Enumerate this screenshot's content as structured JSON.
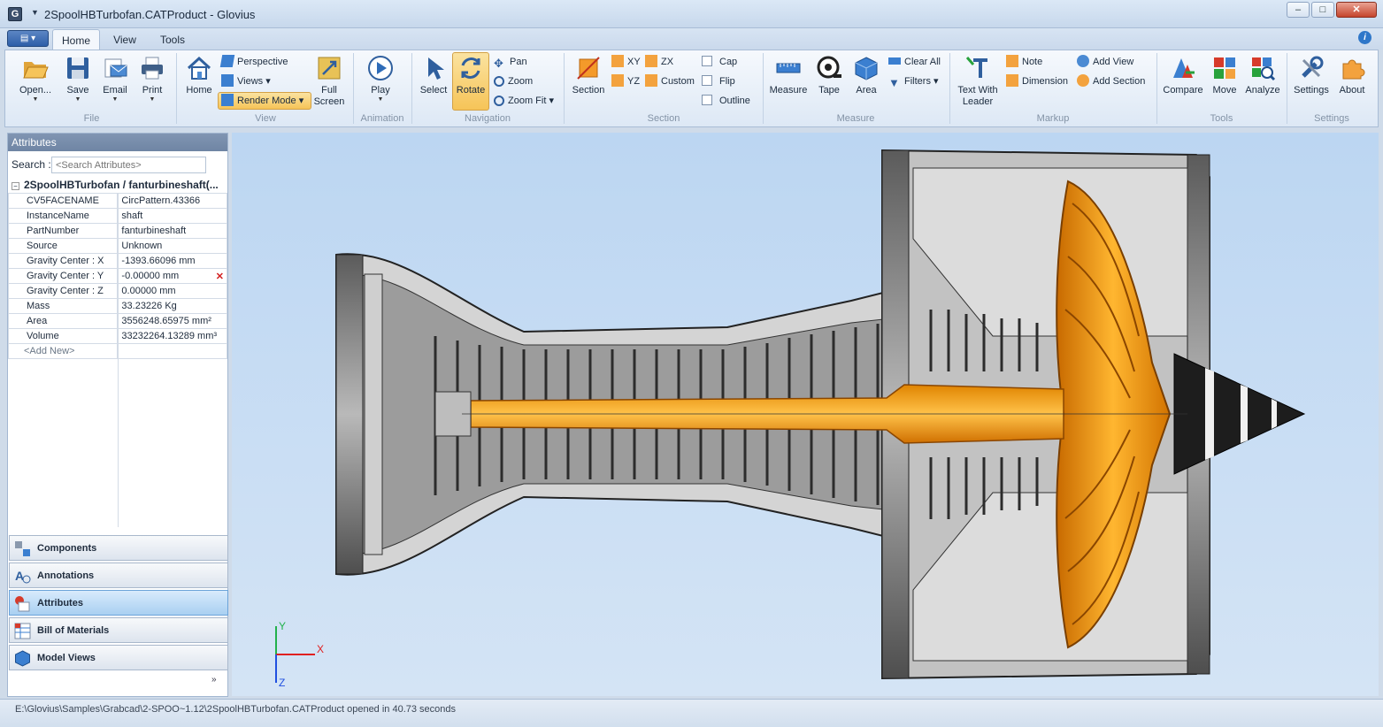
{
  "window": {
    "title": "2SpoolHBTurbofan.CATProduct - Glovius",
    "app_icon": "G",
    "min": "–",
    "max": "□",
    "close": "✕"
  },
  "ribbon_tabs": [
    "Home",
    "View",
    "Tools"
  ],
  "groups": {
    "file": {
      "label": "File",
      "open": "Open...",
      "save": "Save",
      "email": "Email",
      "print": "Print"
    },
    "view": {
      "label": "View",
      "home": "Home",
      "perspective": "Perspective",
      "views": "Views",
      "render_mode": "Render Mode",
      "full_screen": "Full Screen"
    },
    "animation": {
      "label": "Animation",
      "play": "Play"
    },
    "navigation": {
      "label": "Navigation",
      "select": "Select",
      "rotate": "Rotate",
      "pan": "Pan",
      "zoom": "Zoom",
      "zoom_fit": "Zoom Fit"
    },
    "section": {
      "label": "Section",
      "section": "Section",
      "xy": "XY",
      "yz": "YZ",
      "zx": "ZX",
      "custom": "Custom",
      "cap": "Cap",
      "flip": "Flip",
      "outline": "Outline"
    },
    "measure": {
      "label": "Measure",
      "measure": "Measure",
      "tape": "Tape",
      "area": "Area",
      "clear_all": "Clear All",
      "filters": "Filters"
    },
    "markup": {
      "label": "Markup",
      "text_with_leader": "Text With Leader",
      "note": "Note",
      "dimension": "Dimension",
      "add_view": "Add View",
      "add_section": "Add Section"
    },
    "tools": {
      "label": "Tools",
      "compare": "Compare",
      "move": "Move",
      "analyze": "Analyze"
    },
    "settings": {
      "label": "Settings",
      "settings": "Settings",
      "about": "About"
    }
  },
  "attributes": {
    "header": "Attributes",
    "search_label": "Search :",
    "search_placeholder": "<Search Attributes>",
    "tree_title": "2SpoolHBTurbofan / fanturbineshaft(...",
    "rows": [
      {
        "key": "CV5FACENAME",
        "value": "CircPattern.43366"
      },
      {
        "key": "InstanceName",
        "value": "shaft"
      },
      {
        "key": "PartNumber",
        "value": "fanturbineshaft"
      },
      {
        "key": "Source",
        "value": "Unknown"
      },
      {
        "key": "Gravity Center : X",
        "value": "-1393.66096 mm"
      },
      {
        "key": "Gravity Center : Y",
        "value": "-0.00000 mm"
      },
      {
        "key": "Gravity Center : Z",
        "value": "0.00000 mm"
      },
      {
        "key": "Mass",
        "value": "33.23226 Kg"
      },
      {
        "key": "Area",
        "value": "3556248.65975 mm²"
      },
      {
        "key": "Volume",
        "value": "33232264.13289 mm³"
      }
    ],
    "add_new": "<Add New>"
  },
  "nav_panels": [
    "Components",
    "Annotations",
    "Attributes",
    "Bill of Materials",
    "Model Views"
  ],
  "axes": {
    "x": "X",
    "y": "Y",
    "z": "Z"
  },
  "status": "E:\\Glovius\\Samples\\Grabcad\\2-SPOO~1.12\\2SpoolHBTurbofan.CATProduct opened in 40.73 seconds",
  "colors": {
    "accent_orange": "#f59a10",
    "ribbon_blue": "#dde8f5",
    "viewport_bg": "#c8dcf3"
  }
}
